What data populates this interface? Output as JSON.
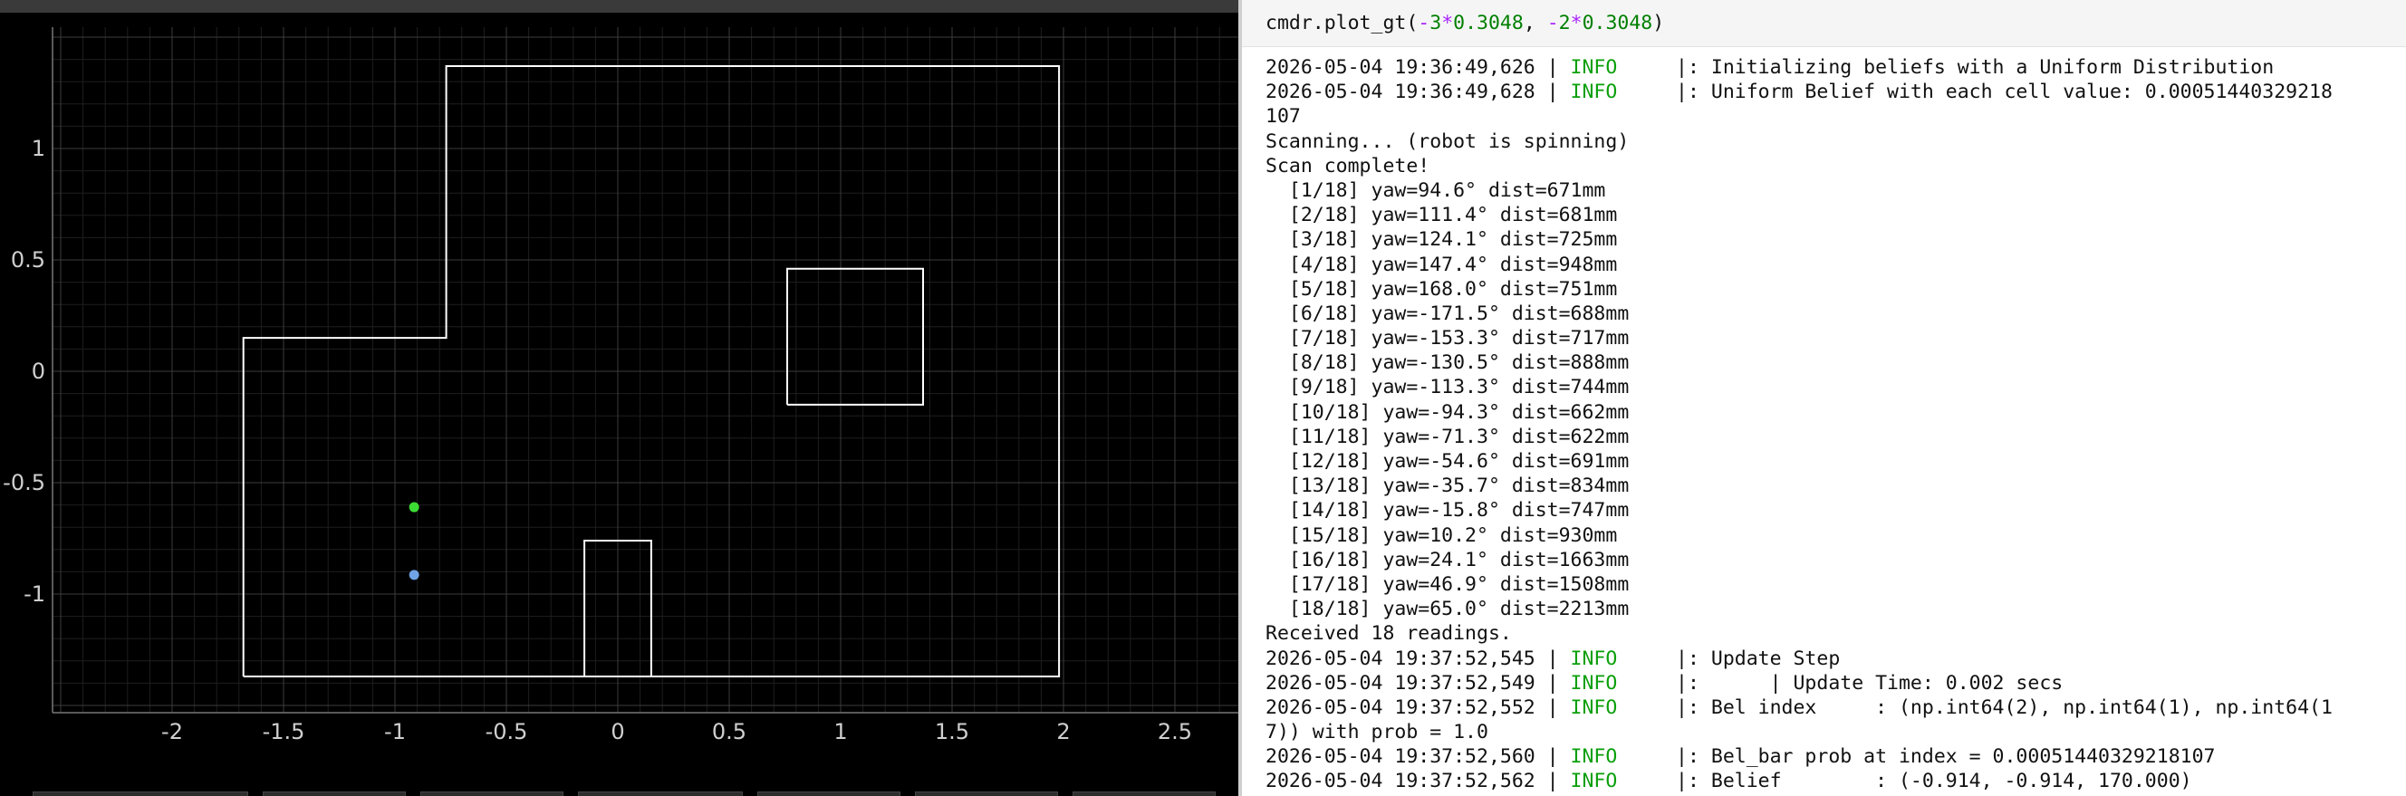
{
  "plot": {
    "x_ticks": [
      "-2",
      "-1.5",
      "-1",
      "-0.5",
      "0",
      "0.5",
      "1",
      "1.5",
      "2",
      "2.5"
    ],
    "y_ticks": [
      "1",
      "0.5",
      "0",
      "-0.5",
      "-1"
    ],
    "colors": {
      "background": "#000000",
      "grid_major": "#3c3c3c",
      "grid_minor": "#1e1e1e",
      "walls": "#ffffff",
      "ground_truth_point": "#3ddc35",
      "belief_point": "#6fa3e6",
      "tick_text": "#cfcfcf"
    },
    "points": {
      "ground_truth": {
        "x": -0.914,
        "y": -0.61
      },
      "belief": {
        "x": -0.914,
        "y": -0.914
      }
    },
    "walls": [
      [
        [
          -1.68,
          -1.37
        ],
        [
          1.98,
          -1.37
        ],
        [
          1.98,
          1.37
        ],
        [
          -0.77,
          1.37
        ],
        [
          -0.77,
          0.15
        ],
        [
          -1.68,
          0.15
        ],
        [
          -1.68,
          -1.37
        ]
      ],
      [
        [
          0.76,
          -0.15
        ],
        [
          1.37,
          -0.15
        ],
        [
          1.37,
          0.46
        ],
        [
          0.76,
          0.46
        ],
        [
          0.76,
          -0.15
        ]
      ],
      [
        [
          -0.15,
          -1.37
        ],
        [
          -0.15,
          -0.76
        ],
        [
          0.15,
          -0.76
        ],
        [
          0.15,
          -1.37
        ]
      ]
    ]
  },
  "notebook": {
    "code": {
      "prefix": "cmdr.plot_gt(",
      "op1": "-",
      "n1": "3",
      "op2": "*",
      "n2": "0.3048",
      "sep": ", ",
      "op3": "-",
      "n3": "2",
      "op4": "*",
      "n4": "0.3048",
      "suffix": ")"
    },
    "output_lines": [
      {
        "a": "2026-05-04 19:36:49,626 | ",
        "b": "INFO",
        "c": "     |: Initializing beliefs with a Uniform Distribution"
      },
      {
        "a": "2026-05-04 19:36:49,628 | ",
        "b": "INFO",
        "c": "     |: Uniform Belief with each cell value: 0.00051440329218"
      },
      {
        "a": "107"
      },
      {
        "a": "Scanning... (robot is spinning)"
      },
      {
        "a": "Scan complete!"
      },
      {
        "a": "  [1/18] yaw=94.6° dist=671mm"
      },
      {
        "a": "  [2/18] yaw=111.4° dist=681mm"
      },
      {
        "a": "  [3/18] yaw=124.1° dist=725mm"
      },
      {
        "a": "  [4/18] yaw=147.4° dist=948mm"
      },
      {
        "a": "  [5/18] yaw=168.0° dist=751mm"
      },
      {
        "a": "  [6/18] yaw=-171.5° dist=688mm"
      },
      {
        "a": "  [7/18] yaw=-153.3° dist=717mm"
      },
      {
        "a": "  [8/18] yaw=-130.5° dist=888mm"
      },
      {
        "a": "  [9/18] yaw=-113.3° dist=744mm"
      },
      {
        "a": "  [10/18] yaw=-94.3° dist=662mm"
      },
      {
        "a": "  [11/18] yaw=-71.3° dist=622mm"
      },
      {
        "a": "  [12/18] yaw=-54.6° dist=691mm"
      },
      {
        "a": "  [13/18] yaw=-35.7° dist=834mm"
      },
      {
        "a": "  [14/18] yaw=-15.8° dist=747mm"
      },
      {
        "a": "  [15/18] yaw=10.2° dist=930mm"
      },
      {
        "a": "  [16/18] yaw=24.1° dist=1663mm"
      },
      {
        "a": "  [17/18] yaw=46.9° dist=1508mm"
      },
      {
        "a": "  [18/18] yaw=65.0° dist=2213mm"
      },
      {
        "a": "Received 18 readings."
      },
      {
        "a": "2026-05-04 19:37:52,545 | ",
        "b": "INFO",
        "c": "     |: Update Step"
      },
      {
        "a": "2026-05-04 19:37:52,549 | ",
        "b": "INFO",
        "c": "     |:      | Update Time: 0.002 secs"
      },
      {
        "a": "2026-05-04 19:37:52,552 | ",
        "b": "INFO",
        "c": "     |: Bel index     : (np.int64(2), np.int64(1), np.int64(1"
      },
      {
        "a": "7)) with prob = 1.0"
      },
      {
        "a": "2026-05-04 19:37:52,560 | ",
        "b": "INFO",
        "c": "     |: Bel_bar prob at index = 0.00051440329218107"
      },
      {
        "a": "2026-05-04 19:37:52,562 | ",
        "b": "INFO",
        "c": "     |: Belief        : (-0.914, -0.914, 170.000)"
      }
    ]
  }
}
